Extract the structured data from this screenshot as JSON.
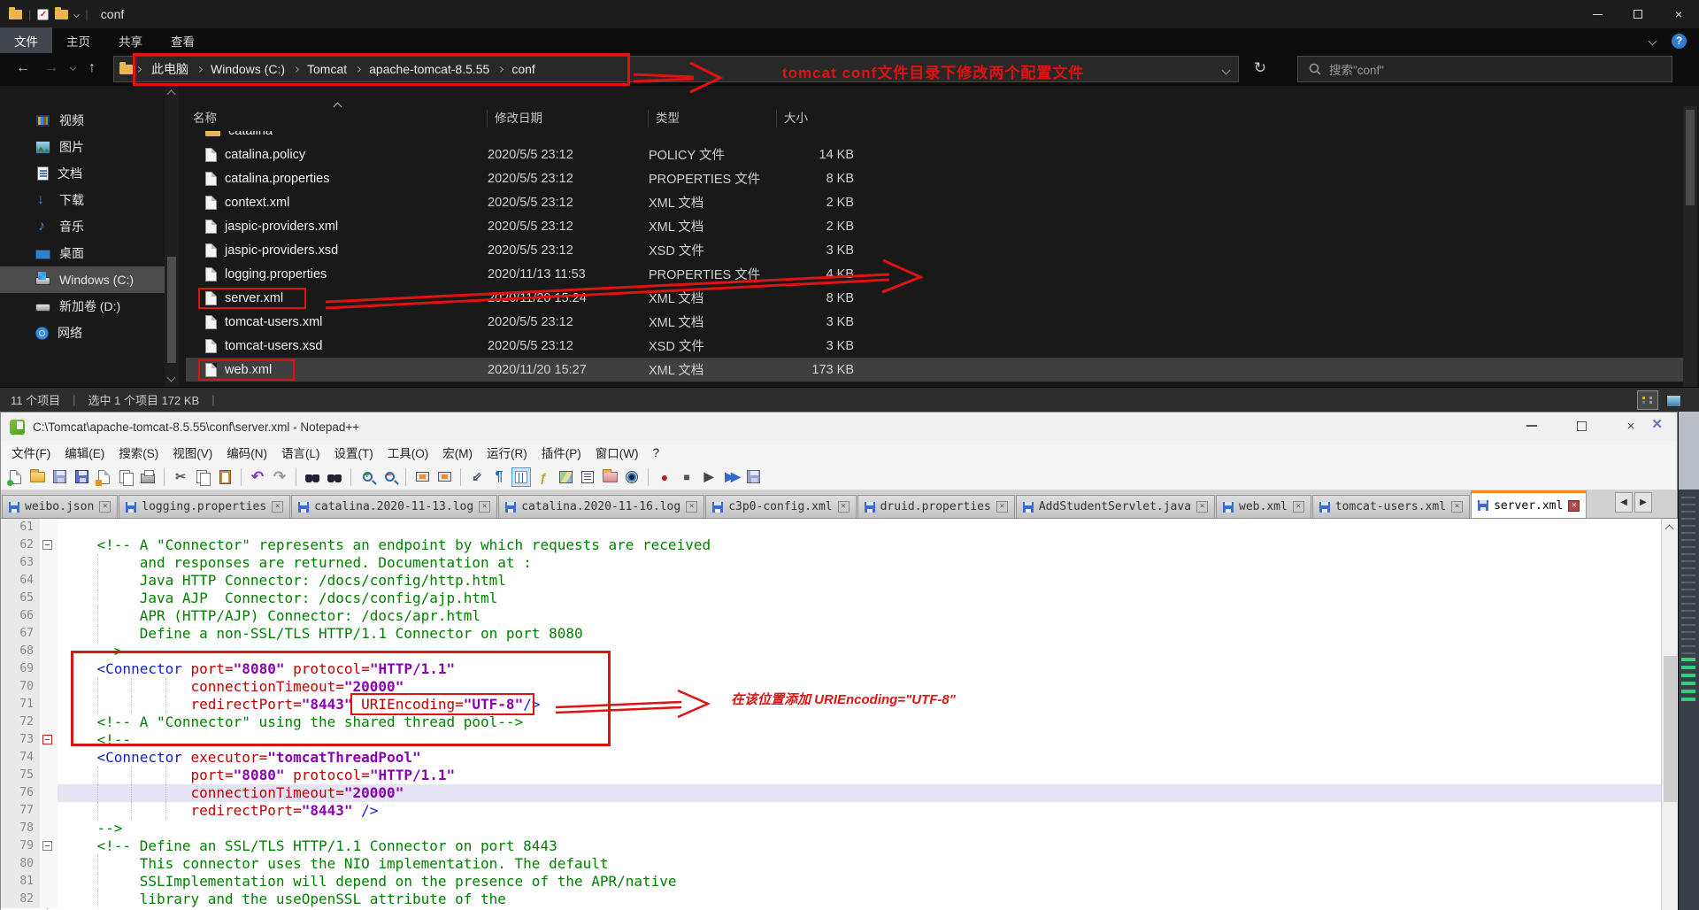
{
  "colors": {
    "annotation_red": "#e11212",
    "accent_orange": "#f9882c",
    "selection_gray": "#3f3f3f"
  },
  "explorer": {
    "window_title": "conf",
    "ribbon_tabs": [
      {
        "id": "file",
        "label": "文件",
        "active": true
      },
      {
        "id": "home",
        "label": "主页"
      },
      {
        "id": "share",
        "label": "共享"
      },
      {
        "id": "view",
        "label": "查看"
      }
    ],
    "breadcrumb": [
      {
        "id": "this-pc",
        "label": "此电脑"
      },
      {
        "id": "windows-c",
        "label": "Windows (C:)"
      },
      {
        "id": "tomcat",
        "label": "Tomcat"
      },
      {
        "id": "apache-tomcat-8-5-55",
        "label": "apache-tomcat-8.5.55"
      },
      {
        "id": "conf",
        "label": "conf"
      }
    ],
    "search_placeholder": "搜索\"conf\"",
    "sidebar": [
      {
        "id": "videos",
        "label": "视频"
      },
      {
        "id": "pictures",
        "label": "图片"
      },
      {
        "id": "documents",
        "label": "文档"
      },
      {
        "id": "downloads",
        "label": "下载"
      },
      {
        "id": "music",
        "label": "音乐"
      },
      {
        "id": "desktop",
        "label": "桌面"
      },
      {
        "id": "drive-c",
        "label": "Windows (C:)",
        "selected": true
      },
      {
        "id": "drive-d",
        "label": "新加卷 (D:)"
      },
      {
        "id": "network",
        "label": "网络"
      }
    ],
    "columns": [
      "名称",
      "修改日期",
      "类型",
      "大小"
    ],
    "files": [
      {
        "name": "catalina",
        "folder": true,
        "date": "",
        "type": "",
        "size": "",
        "partial": true
      },
      {
        "name": "catalina.policy",
        "date": "2020/5/5 23:12",
        "type": "POLICY 文件",
        "size": "14 KB"
      },
      {
        "name": "catalina.properties",
        "date": "2020/5/5 23:12",
        "type": "PROPERTIES 文件",
        "size": "8 KB"
      },
      {
        "name": "context.xml",
        "date": "2020/5/5 23:12",
        "type": "XML 文档",
        "size": "2 KB"
      },
      {
        "name": "jaspic-providers.xml",
        "date": "2020/5/5 23:12",
        "type": "XML 文档",
        "size": "2 KB"
      },
      {
        "name": "jaspic-providers.xsd",
        "date": "2020/5/5 23:12",
        "type": "XSD 文件",
        "size": "3 KB"
      },
      {
        "name": "logging.properties",
        "date": "2020/11/13 11:53",
        "type": "PROPERTIES 文件",
        "size": "4 KB"
      },
      {
        "name": "server.xml",
        "date": "2020/11/20 15:24",
        "type": "XML 文档",
        "size": "8 KB",
        "redbox": true
      },
      {
        "name": "tomcat-users.xml",
        "date": "2020/5/5 23:12",
        "type": "XML 文档",
        "size": "3 KB"
      },
      {
        "name": "tomcat-users.xsd",
        "date": "2020/5/5 23:12",
        "type": "XSD 文件",
        "size": "3 KB"
      },
      {
        "name": "web.xml",
        "date": "2020/11/20 15:27",
        "type": "XML 文档",
        "size": "173 KB",
        "redbox": true,
        "selected": true
      }
    ],
    "status_items": "11 个项目",
    "status_selected": "选中 1 个项目 172 KB"
  },
  "annotations": {
    "top_text": "tomcat conf文件目录下修改两个配置文件",
    "code_text": "在该位置添加 URIEncoding=\"UTF-8\""
  },
  "notepad": {
    "window_title": "C:\\Tomcat\\apache-tomcat-8.5.55\\conf\\server.xml - Notepad++",
    "menus": [
      "文件(F)",
      "编辑(E)",
      "搜索(S)",
      "视图(V)",
      "编码(N)",
      "语言(L)",
      "设置(T)",
      "工具(O)",
      "宏(M)",
      "运行(R)",
      "插件(P)",
      "窗口(W)",
      "?"
    ],
    "toolbar": [
      "new-file",
      "open",
      "save",
      "save-all",
      "close",
      "close-all",
      "print",
      "cut",
      "copy",
      "paste",
      "undo",
      "redo",
      "find",
      "replace",
      "zoom-in",
      "zoom-out",
      "sync-vertical",
      "sync-horizontal",
      "word-wrap",
      "show-all-characters",
      "indent-guide",
      "function-list",
      "document-map",
      "document-list",
      "folder-as-workspace",
      "file-monitoring",
      "macro-record",
      "macro-stop",
      "macro-play",
      "macro-run-multiple",
      "macro-save"
    ],
    "tabs": [
      {
        "label": "weibo.json"
      },
      {
        "label": "logging.properties"
      },
      {
        "label": "catalina.2020-11-13.log"
      },
      {
        "label": "catalina.2020-11-16.log"
      },
      {
        "label": "c3p0-config.xml"
      },
      {
        "label": "druid.properties"
      },
      {
        "label": "AddStudentServlet.java"
      },
      {
        "label": "web.xml"
      },
      {
        "label": "tomcat-users.xml"
      },
      {
        "label": "server.xml",
        "active": true
      }
    ],
    "code": [
      {
        "n": 61,
        "tokens": []
      },
      {
        "n": 62,
        "fold": "gray",
        "tokens": [
          {
            "s": "c",
            "t": "    <!-- A \"Connector\" represents an endpoint by which requests are received"
          }
        ]
      },
      {
        "n": 63,
        "tokens": [
          {
            "s": "c",
            "t": "         and responses are returned. Documentation at :"
          }
        ]
      },
      {
        "n": 64,
        "tokens": [
          {
            "s": "c",
            "t": "         Java HTTP Connector: /docs/config/http.html"
          }
        ]
      },
      {
        "n": 65,
        "tokens": [
          {
            "s": "c",
            "t": "         Java AJP  Connector: /docs/config/ajp.html"
          }
        ]
      },
      {
        "n": 66,
        "tokens": [
          {
            "s": "c",
            "t": "         APR (HTTP/AJP) Connector: /docs/apr.html"
          }
        ]
      },
      {
        "n": 67,
        "tokens": [
          {
            "s": "c",
            "t": "         Define a non-SSL/TLS HTTP/1.1 Connector on port 8080"
          }
        ]
      },
      {
        "n": 68,
        "tokens": [
          {
            "s": "c",
            "t": "    -->"
          }
        ]
      },
      {
        "n": 69,
        "tokens": [
          {
            "s": "p",
            "t": "    "
          },
          {
            "s": "t",
            "t": "<Connector "
          },
          {
            "s": "a",
            "t": "port="
          },
          {
            "s": "v",
            "t": "\"8080\""
          },
          {
            "s": "p",
            "t": " "
          },
          {
            "s": "a",
            "t": "protocol="
          },
          {
            "s": "v",
            "t": "\"HTTP/1.1\""
          }
        ]
      },
      {
        "n": 70,
        "tokens": [
          {
            "s": "p",
            "t": "               "
          },
          {
            "s": "a",
            "t": "connectionTimeout="
          },
          {
            "s": "v",
            "t": "\"20000\""
          }
        ]
      },
      {
        "n": 71,
        "tokens": [
          {
            "s": "p",
            "t": "               "
          },
          {
            "s": "a",
            "t": "redirectPort="
          },
          {
            "s": "v",
            "t": "\"8443\""
          },
          {
            "box": [
              {
                "s": "p",
                "t": " "
              },
              {
                "s": "a",
                "t": "URIEncoding="
              },
              {
                "s": "v",
                "t": "\"UTF-8\""
              },
              {
                "s": "t",
                "t": "/"
              }
            ]
          },
          {
            "s": "t",
            "t": ">"
          }
        ]
      },
      {
        "n": 72,
        "tokens": [
          {
            "s": "c",
            "t": "    <!-- A \"Connector\" using the shared thread pool-->"
          }
        ]
      },
      {
        "n": 73,
        "fold": "red",
        "tokens": [
          {
            "s": "c",
            "t": "    <!--"
          }
        ]
      },
      {
        "n": 74,
        "tokens": [
          {
            "s": "p",
            "t": "    "
          },
          {
            "s": "t",
            "t": "<Connector "
          },
          {
            "s": "a",
            "t": "executor="
          },
          {
            "s": "v",
            "t": "\"tomcatThreadPool\""
          }
        ]
      },
      {
        "n": 75,
        "tokens": [
          {
            "s": "p",
            "t": "               "
          },
          {
            "s": "a",
            "t": "port="
          },
          {
            "s": "v",
            "t": "\"8080\""
          },
          {
            "s": "p",
            "t": " "
          },
          {
            "s": "a",
            "t": "protocol="
          },
          {
            "s": "v",
            "t": "\"HTTP/1.1\""
          }
        ]
      },
      {
        "n": 76,
        "hl": true,
        "tokens": [
          {
            "s": "p",
            "t": "               "
          },
          {
            "s": "a",
            "t": "connectionTimeout="
          },
          {
            "s": "v",
            "t": "\"20000\""
          }
        ]
      },
      {
        "n": 77,
        "tokens": [
          {
            "s": "p",
            "t": "               "
          },
          {
            "s": "a",
            "t": "redirectPort="
          },
          {
            "s": "v",
            "t": "\"8443\""
          },
          {
            "s": "p",
            "t": " "
          },
          {
            "s": "t",
            "t": "/>"
          }
        ]
      },
      {
        "n": 78,
        "tokens": [
          {
            "s": "c",
            "t": "    -->"
          }
        ]
      },
      {
        "n": 79,
        "fold": "gray",
        "tokens": [
          {
            "s": "c",
            "t": "    <!-- Define an SSL/TLS HTTP/1.1 Connector on port 8443"
          }
        ]
      },
      {
        "n": 80,
        "tokens": [
          {
            "s": "c",
            "t": "         This connector uses the NIO implementation. The default"
          }
        ]
      },
      {
        "n": 81,
        "tokens": [
          {
            "s": "c",
            "t": "         SSLImplementation will depend on the presence of the APR/native"
          }
        ]
      },
      {
        "n": 82,
        "tokens": [
          {
            "s": "c",
            "t": "         library and the useOpenSSL attribute of the"
          }
        ]
      }
    ]
  }
}
